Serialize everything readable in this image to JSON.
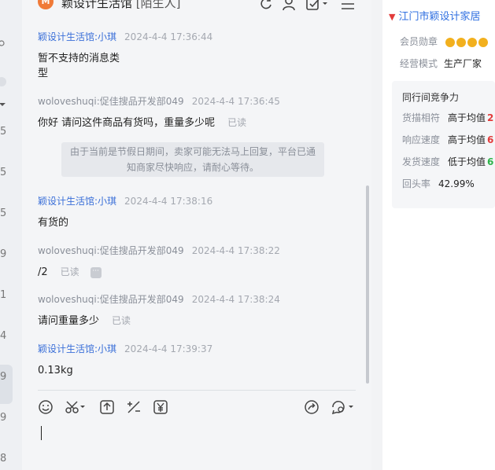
{
  "left_strip": {
    "numbers": [
      "5",
      "5",
      "5",
      "9",
      "1",
      "4",
      "9",
      "9",
      "8"
    ]
  },
  "header": {
    "title": "颖设计生活馆",
    "stranger_tag": "[陌生人]"
  },
  "messages": [
    {
      "sender": "颖设计生活馆:小琪",
      "time": "2024-4-4 17:36:44",
      "lines": [
        "暂不支持的消息类",
        "型"
      ],
      "read": "",
      "role": "seller"
    },
    {
      "sender": "woloveshuqi:促佳搜品开发部049",
      "time": "2024-4-4 17:36:45",
      "lines": [
        "你好 请问这件商品有货吗，重量多少呢"
      ],
      "read": "已读",
      "role": "buyer"
    },
    {
      "sender": "颖设计生活馆:小琪",
      "time": "2024-4-4 17:38:16",
      "lines": [
        "有货的"
      ],
      "read": "",
      "role": "seller"
    },
    {
      "sender": "woloveshuqi:促佳搜品开发部049",
      "time": "2024-4-4 17:38:22",
      "lines": [
        "/2"
      ],
      "read": "已读",
      "role": "buyer"
    },
    {
      "sender": "woloveshuqi:促佳搜品开发部049",
      "time": "2024-4-4 17:38:24",
      "lines": [
        "请问重量多少"
      ],
      "read": "已读",
      "role": "buyer"
    },
    {
      "sender": "颖设计生活馆:小琪",
      "time": "2024-4-4 17:39:37",
      "lines": [
        "0.13kg"
      ],
      "read": "",
      "role": "seller"
    }
  ],
  "notice": {
    "line1": "由于当前是节假日期间，卖家可能无法马上回复，平台已通",
    "line2": "知商家尽快响应，请耐心等待。"
  },
  "icons": {
    "header": [
      "refresh-icon",
      "user-icon",
      "check-icon",
      "menu-icon"
    ],
    "toolbar": [
      "emoji-icon",
      "scissors-icon",
      "upload-icon",
      "ratio-icon",
      "yen-icon",
      "share-icon",
      "chat-settings-icon"
    ]
  },
  "company": {
    "name": "江门市颖设计家居",
    "rows": [
      {
        "key": "会员勋章",
        "value": ""
      },
      {
        "key": "经营模式",
        "value": "生产厂家"
      }
    ]
  },
  "competition": {
    "title": "同行间竞争力",
    "rows": [
      {
        "key": "货描相符",
        "value": "高于均值",
        "num": "2",
        "num_color": "#e23b3b"
      },
      {
        "key": "响应速度",
        "value": "高于均值",
        "num": "6",
        "num_color": "#e23b3b"
      },
      {
        "key": "发货速度",
        "value": "低于均值",
        "num": "6",
        "num_color": "#2eb34a"
      },
      {
        "key": "回头率",
        "value": "42.99%",
        "num": "",
        "num_color": "#222222"
      }
    ]
  },
  "colors": {
    "seller_name": "#3a6fd8",
    "buyer_name": "#8a8f99",
    "brand_logo": "#f07a38",
    "company_link": "#2f6fe0"
  }
}
